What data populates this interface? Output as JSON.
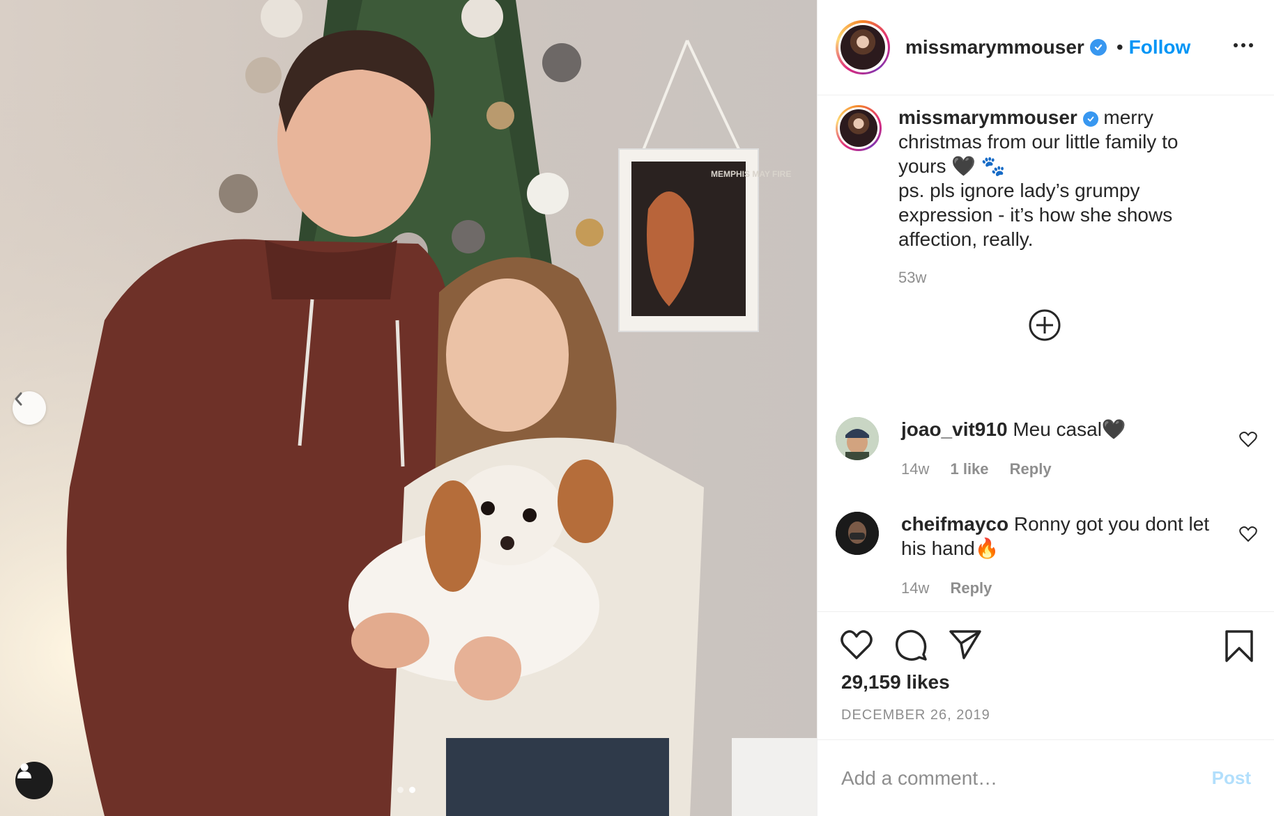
{
  "post": {
    "photo_alt": "Couple with dog in front of Christmas tree",
    "poster_text": "MEMPHIS MAY FIRE"
  },
  "header": {
    "username": "missmarymmouser",
    "separator": "•",
    "follow_label": "Follow"
  },
  "caption": {
    "username": "missmarymmouser",
    "text": "merry christmas from our little family to yours 🖤 🐾",
    "text2": "ps. pls ignore lady’s grumpy expression - it’s how she shows affection, really.",
    "time": "53w"
  },
  "comments": [
    {
      "username": "joao_vit910",
      "text": "Meu casal🖤",
      "time": "14w",
      "likes": "1 like",
      "reply": "Reply"
    },
    {
      "username": "cheifmayco",
      "text": "Ronny got you dont let his hand🔥",
      "time": "14w",
      "reply": "Reply"
    }
  ],
  "likes": "29,159 likes",
  "date": "DECEMBER 26, 2019",
  "add_comment": {
    "placeholder": "Add a comment…",
    "post_label": "Post"
  },
  "colors": {
    "accent": "#0095f6",
    "verified": "#3897f0",
    "muted": "#8e8e8e"
  }
}
